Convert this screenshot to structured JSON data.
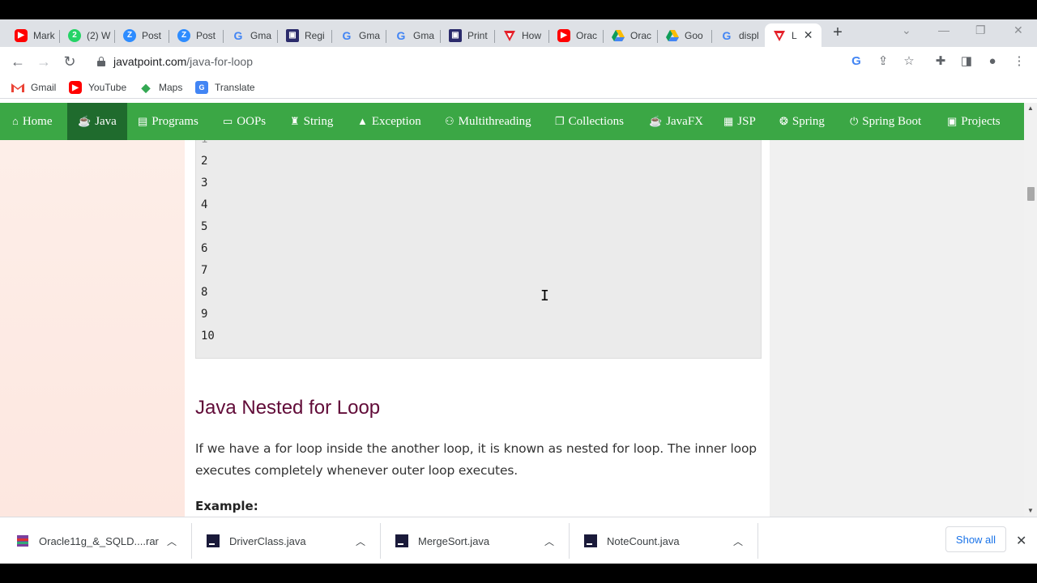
{
  "browser": {
    "tabs": [
      {
        "label": "Mark",
        "icon": "youtube-icon"
      },
      {
        "label": "(2) W",
        "icon": "whatsapp-icon"
      },
      {
        "label": "Post",
        "icon": "zoom-icon"
      },
      {
        "label": "Post",
        "icon": "zoom-icon"
      },
      {
        "label": "Gma",
        "icon": "google-icon"
      },
      {
        "label": "Regi",
        "icon": "intellij-icon"
      },
      {
        "label": "Gma",
        "icon": "google-icon"
      },
      {
        "label": "Gma",
        "icon": "google-icon"
      },
      {
        "label": "Print",
        "icon": "intellij-icon"
      },
      {
        "label": "How",
        "icon": "javatpoint-icon"
      },
      {
        "label": "Orac",
        "icon": "youtube-icon"
      },
      {
        "label": "Orac",
        "icon": "google-drive-icon"
      },
      {
        "label": "Goo",
        "icon": "google-drive-icon"
      },
      {
        "label": "displ",
        "icon": "google-icon"
      },
      {
        "label": "L",
        "icon": "javatpoint-icon"
      }
    ],
    "new_tab": "+",
    "url_domain": "javatpoint.com",
    "url_path": "/java-for-loop",
    "bookmarks": [
      "Gmail",
      "YouTube",
      "Maps",
      "Translate"
    ]
  },
  "site_nav": {
    "items": [
      "Home",
      "Java",
      "Programs",
      "OOPs",
      "String",
      "Exception",
      "Multithreading",
      "Collections",
      "JavaFX",
      "JSP",
      "Spring",
      "Spring Boot",
      "Projects"
    ],
    "active": "Java",
    "colors": {
      "bar": "#3ba745",
      "active": "#1f6b2d"
    }
  },
  "content": {
    "code_output": [
      "2",
      "3",
      "4",
      "5",
      "6",
      "7",
      "8",
      "9",
      "10"
    ],
    "heading": "Java Nested for Loop",
    "paragraph": "If we have a for loop inside the another loop, it is known as nested for loop. The inner loop executes completely whenever outer loop executes.",
    "example_label": "Example:"
  },
  "downloads": {
    "items": [
      "Oracle11g_&_SQLD....rar",
      "DriverClass.java",
      "MergeSort.java",
      "NoteCount.java"
    ],
    "show_all": "Show all"
  }
}
